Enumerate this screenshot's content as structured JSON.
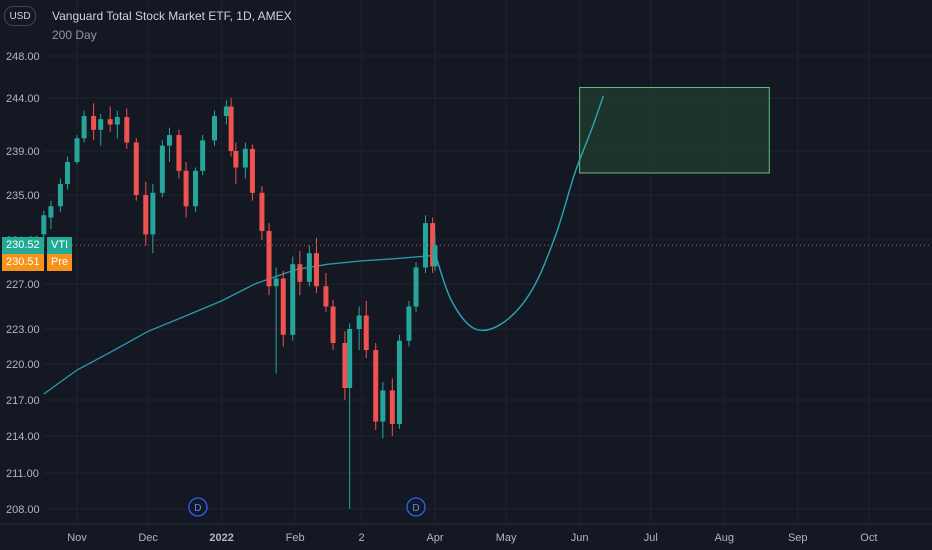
{
  "header": {
    "title": "Vanguard Total Stock Market ETF, 1D, AMEX",
    "indicator": "200 Day",
    "currency": "USD"
  },
  "price_badges": [
    {
      "price": "230.52",
      "tag": "VTI",
      "color": "#22ab94",
      "tagColor": "#22ab94"
    },
    {
      "price": "230.51",
      "tag": "Pre",
      "color": "#f7931a",
      "tagColor": "#f7931a"
    }
  ],
  "dividend_marker": "D",
  "colors": {
    "background": "#141823",
    "up": "#26a69a",
    "down": "#ef5350",
    "ma": "#2a9bab",
    "projection": "#2aa6b4",
    "target_fill": "#1e3a2e",
    "target_border": "#64bb83",
    "price_line": "#e0474c"
  },
  "chart_data": {
    "type": "candlestick",
    "symbol": "VTI",
    "y_ticks": [
      "208.00",
      "211.00",
      "214.00",
      "217.00",
      "220.00",
      "223.00",
      "227.00",
      "231.00",
      "235.00",
      "239.00",
      "244.00",
      "248.00"
    ],
    "y_tick_values": [
      208,
      211,
      214,
      217,
      220,
      223,
      227,
      231,
      235,
      239,
      244,
      248
    ],
    "x_ticks": [
      "Nov",
      "Dec",
      "2022",
      "Feb",
      "2",
      "Apr",
      "May",
      "Jun",
      "Jul",
      "Aug",
      "Sep",
      "Oct"
    ],
    "last_price": 230.52,
    "premarket_price": 230.51,
    "target_zone": {
      "from": "2022-06-01",
      "to": "2022-08-20",
      "low": 237.0,
      "high": 245.0
    },
    "candles": [
      [
        "2021-10-18",
        231.5,
        233.6,
        230.8,
        233.2
      ],
      [
        "2021-10-21",
        233.0,
        234.5,
        232.0,
        234.0
      ],
      [
        "2021-10-25",
        234.0,
        236.5,
        233.5,
        236.0
      ],
      [
        "2021-10-28",
        236.0,
        238.5,
        235.5,
        238.0
      ],
      [
        "2021-11-01",
        238.0,
        240.5,
        237.8,
        240.2
      ],
      [
        "2021-11-04",
        240.2,
        242.8,
        239.8,
        242.3
      ],
      [
        "2021-11-08",
        242.3,
        243.5,
        240.0,
        241.0
      ],
      [
        "2021-11-11",
        241.0,
        242.5,
        239.5,
        242.0
      ],
      [
        "2021-11-15",
        242.0,
        243.2,
        240.8,
        241.5
      ],
      [
        "2021-11-18",
        241.5,
        242.8,
        240.2,
        242.2
      ],
      [
        "2021-11-22",
        242.2,
        243.0,
        239.2,
        239.8
      ],
      [
        "2021-11-26",
        239.8,
        240.2,
        234.5,
        235.0
      ],
      [
        "2021-11-30",
        235.0,
        236.2,
        230.5,
        231.5
      ],
      [
        "2021-12-03",
        231.5,
        236.0,
        229.8,
        235.2
      ],
      [
        "2021-12-07",
        235.2,
        240.0,
        234.8,
        239.5
      ],
      [
        "2021-12-10",
        239.5,
        241.2,
        238.0,
        240.5
      ],
      [
        "2021-12-14",
        240.5,
        241.0,
        236.5,
        237.2
      ],
      [
        "2021-12-17",
        237.2,
        238.0,
        233.0,
        234.0
      ],
      [
        "2021-12-21",
        234.0,
        237.5,
        233.5,
        237.2
      ],
      [
        "2021-12-24",
        237.2,
        240.5,
        236.8,
        240.0
      ],
      [
        "2021-12-29",
        240.0,
        242.8,
        239.5,
        242.3
      ],
      [
        "2022-01-03",
        242.3,
        243.8,
        241.5,
        243.2
      ],
      [
        "2022-01-05",
        243.2,
        244.0,
        238.5,
        239.0
      ],
      [
        "2022-01-07",
        239.0,
        239.8,
        236.0,
        237.5
      ],
      [
        "2022-01-11",
        237.5,
        239.8,
        236.5,
        239.2
      ],
      [
        "2022-01-14",
        239.2,
        239.6,
        234.5,
        235.2
      ],
      [
        "2022-01-18",
        235.2,
        235.8,
        231.0,
        231.8
      ],
      [
        "2022-01-21",
        231.8,
        232.5,
        226.0,
        226.8
      ],
      [
        "2022-01-24",
        226.8,
        228.5,
        219.2,
        227.5
      ],
      [
        "2022-01-27",
        227.5,
        228.2,
        221.5,
        222.5
      ],
      [
        "2022-01-31",
        222.5,
        229.5,
        222.0,
        228.8
      ],
      [
        "2022-02-03",
        228.8,
        230.0,
        226.0,
        227.2
      ],
      [
        "2022-02-07",
        227.2,
        230.5,
        226.8,
        229.8
      ],
      [
        "2022-02-10",
        229.8,
        231.2,
        226.2,
        226.8
      ],
      [
        "2022-02-14",
        226.8,
        228.0,
        224.5,
        225.0
      ],
      [
        "2022-02-17",
        225.0,
        225.6,
        221.2,
        221.8
      ],
      [
        "2022-02-22",
        221.8,
        222.8,
        217.0,
        218.0
      ],
      [
        "2022-02-24",
        218.0,
        223.5,
        208.0,
        223.0
      ],
      [
        "2022-02-28",
        223.0,
        225.0,
        221.2,
        224.2
      ],
      [
        "2022-03-03",
        224.2,
        225.5,
        220.5,
        221.2
      ],
      [
        "2022-03-07",
        221.2,
        221.8,
        214.5,
        215.2
      ],
      [
        "2022-03-10",
        215.2,
        218.5,
        213.8,
        217.8
      ],
      [
        "2022-03-14",
        217.8,
        218.8,
        214.0,
        215.0
      ],
      [
        "2022-03-17",
        215.0,
        222.5,
        214.6,
        222.0
      ],
      [
        "2022-03-21",
        222.0,
        225.5,
        221.5,
        225.0
      ],
      [
        "2022-03-24",
        225.0,
        229.0,
        224.5,
        228.5
      ],
      [
        "2022-03-28",
        228.5,
        233.2,
        228.0,
        232.5
      ],
      [
        "2022-03-31",
        232.5,
        233.0,
        228.0,
        228.6
      ],
      [
        "2022-04-01",
        228.6,
        231.5,
        228.2,
        230.5
      ]
    ],
    "moving_average": [
      [
        "2021-10-18",
        217.5
      ],
      [
        "2021-11-01",
        219.5
      ],
      [
        "2021-11-15",
        221.0
      ],
      [
        "2021-12-01",
        222.8
      ],
      [
        "2021-12-15",
        224.0
      ],
      [
        "2022-01-01",
        225.5
      ],
      [
        "2022-01-15",
        227.0
      ],
      [
        "2022-02-01",
        228.3
      ],
      [
        "2022-02-15",
        228.8
      ],
      [
        "2022-03-01",
        229.1
      ],
      [
        "2022-03-15",
        229.3
      ],
      [
        "2022-04-01",
        229.6
      ]
    ],
    "projection": [
      [
        "2022-04-01",
        229.8
      ],
      [
        "2022-04-08",
        225.5
      ],
      [
        "2022-04-18",
        223.0
      ],
      [
        "2022-04-30",
        223.6
      ],
      [
        "2022-05-12",
        226.5
      ],
      [
        "2022-05-22",
        231.5
      ],
      [
        "2022-05-30",
        237.0
      ],
      [
        "2022-06-06",
        241.0
      ],
      [
        "2022-06-11",
        244.2
      ]
    ]
  }
}
